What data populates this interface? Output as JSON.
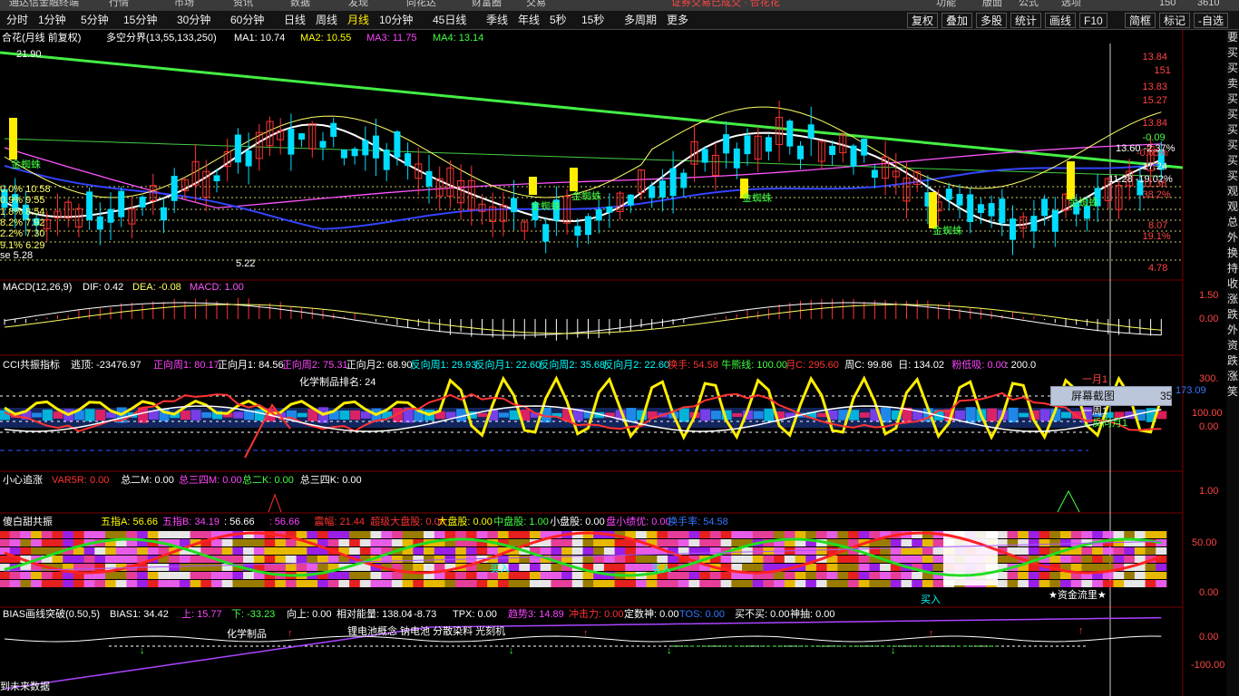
{
  "top_menu": [
    "通达信金融终端",
    "行情",
    "市场",
    "资讯",
    "数据",
    "发现",
    "同花达",
    "财富圈",
    "交易",
    "功能",
    "版面",
    "公式",
    "选项",
    "150",
    "3610"
  ],
  "top_alert": "证券交易已成交 · 合花花",
  "period_tabs": [
    "分时",
    "1分钟",
    "5分钟",
    "15分钟",
    "30分钟",
    "60分钟",
    "日线",
    "周线",
    "月线",
    "10分钟",
    "45日线",
    "季线",
    "年线",
    "5秒",
    "15秒",
    "多周期",
    "更多"
  ],
  "active_period": "月线",
  "tools": [
    "复权",
    "叠加",
    "多股",
    "统计",
    "画线",
    "F10",
    "简框",
    "标记",
    "-自选",
    "»"
  ],
  "main_panel": {
    "title": "合花(月线 前复权)",
    "indicator": "多空分界(13,55,133,250)",
    "ma": [
      {
        "label": "MA1: 10.74",
        "color": "#ffffff"
      },
      {
        "label": "MA2: 10.55",
        "color": "#ffff00"
      },
      {
        "label": "MA3: 11.75",
        "color": "#ff44ff"
      },
      {
        "label": "MA4: 13.14",
        "color": "#44ff44"
      }
    ],
    "price_labels": [
      "21.90",
      "5.22",
      "se 5.28"
    ],
    "left_fib": [
      "0.0% 10.58",
      "0.9% 9.55",
      "1.8% 8.54",
      "8.2% 7.92",
      "2.2% 7.30",
      "9.1% 6.29"
    ],
    "candle_tags": [
      "金蜘蛛",
      "金蜘蛛",
      "金蜘蛛",
      "金蜘蛛",
      "金蜘蛛",
      "金蜘蛛"
    ],
    "right_labels": [
      "13.60 -2.37%",
      "11.28 -19.02%"
    ],
    "axis": [
      "13.84",
      "151",
      "13.83",
      "15.27",
      "13.84",
      "-0.09",
      "-0.65%",
      "17.24",
      "11.36",
      "38.2%",
      "8.07",
      "19.1%",
      "4.78"
    ]
  },
  "macd": {
    "title": "MACD(12,26,9)",
    "dif": "DIF: 0.42",
    "dea": "DEA: -0.08",
    "macd": "MACD: 1.00",
    "axis": [
      "1.50",
      "0.00"
    ]
  },
  "cci": {
    "title": "CCI共振指标",
    "escape": "逃顶: -23476.97",
    "items": [
      {
        "t": "正向周1: 80.17",
        "c": "#ff44ff"
      },
      {
        "t": "正向月1: 84.56",
        "c": "#ffffff"
      },
      {
        "t": "正向周2: 75.31",
        "c": "#ff44ff"
      },
      {
        "t": "正向月2: 68.90",
        "c": "#ffffff"
      },
      {
        "t": "反向周1: 29.93",
        "c": "#00ffff"
      },
      {
        "t": "反向月1: 22.60",
        "c": "#00ffff"
      },
      {
        "t": "反向周2: 35.68",
        "c": "#00ffff"
      },
      {
        "t": "反向月2: 22.60",
        "c": "#00ffff"
      },
      {
        "t": "换手: 54.58",
        "c": "#ff3333"
      },
      {
        "t": "牛熊线: 100.00",
        "c": "#44ff44"
      },
      {
        "t": "月C: 295.60",
        "c": "#ff3333"
      },
      {
        "t": "周C: 99.86",
        "c": "#ffffff"
      },
      {
        "t": "日: 134.02",
        "c": "#ffffff"
      },
      {
        "t": "粉低吸: 0.00",
        "c": "#ff44ff"
      },
      {
        "t": ": 200.0",
        "c": "#ffffff"
      }
    ],
    "rank": "化学制品排名:  24",
    "annot": [
      "一月1",
      "一周1",
      "←反向月1"
    ],
    "axis": [
      "300.",
      "173.09",
      "100.00",
      "0.00"
    ]
  },
  "xxzz": {
    "title": "小心追涨",
    "items": [
      {
        "t": "VAR5R: 0.00",
        "c": "#ff3333"
      },
      {
        "t": "总二M: 0.00",
        "c": "#ffffff"
      },
      {
        "t": "总三四M: 0.00",
        "c": "#ff44ff"
      },
      {
        "t": "总二K: 0.00",
        "c": "#44ff44"
      },
      {
        "t": "总三四K: 0.00",
        "c": "#ffffff"
      }
    ],
    "axis": [
      "1.00"
    ]
  },
  "sbt": {
    "title": "傻白甜共振",
    "items": [
      {
        "t": "五指A: 56.66",
        "c": "#ffff00"
      },
      {
        "t": "五指B: 34.19",
        "c": "#ff44ff"
      },
      {
        "t": ": 56.66",
        "c": "#ffffff"
      },
      {
        "t": ": 56.66",
        "c": "#ff44ff"
      },
      {
        "t": "震幅: 21.44",
        "c": "#ff3333"
      },
      {
        "t": "超级大盘股: 0.00",
        "c": "#ff3333"
      },
      {
        "t": "大盘股: 0.00",
        "c": "#ffff00"
      },
      {
        "t": "中盘股: 1.00",
        "c": "#44ff44"
      },
      {
        "t": "小盘股: 0.00",
        "c": "#ffffff"
      },
      {
        "t": "盘小绩优: 0.00",
        "c": "#ff44ff"
      },
      {
        "t": "换手率: 54.58",
        "c": "#3377ff"
      }
    ],
    "buy": [
      "买入",
      "买入",
      "买入"
    ],
    "fund": "★资金流里★",
    "axis": [
      "50.00",
      "0.00"
    ]
  },
  "bias": {
    "title": "BIAS画线突破(0.50,5)",
    "items": [
      {
        "t": "BIAS1: 34.42",
        "c": "#ffffff"
      },
      {
        "t": "上: 15.77",
        "c": "#ff44ff"
      },
      {
        "t": "下: -33.23",
        "c": "#44ff44"
      },
      {
        "t": "向上: 0.00",
        "c": "#ffffff"
      },
      {
        "t": "相对能量: 138.04",
        "c": "#ffffff"
      },
      {
        "t": ": -8.73",
        "c": "#ffffff"
      },
      {
        "t": "TPX: 0.00",
        "c": "#ffffff"
      },
      {
        "t": "趋势3: 14.89",
        "c": "#ff44ff"
      },
      {
        "t": "冲击力: 0.00",
        "c": "#ff3333"
      },
      {
        "t": "定数神: 0.00",
        "c": "#ffffff"
      },
      {
        "t": "TOS: 0.00",
        "c": "#3377ff"
      },
      {
        "t": "买不买: 0.00",
        "c": "#ffffff"
      },
      {
        "t": "神抽: 0.00",
        "c": "#ffffff"
      }
    ],
    "tags": [
      "化学制品",
      "锂电池概念 钠电池 分散染料 光刻机"
    ],
    "axis": [
      "0.00",
      "-100.00"
    ],
    "footer": "到未来数据"
  },
  "popup": {
    "label": "屏幕截图",
    "count": "35"
  },
  "right_strip": [
    "要",
    "买",
    "买",
    "卖",
    "买",
    "买",
    "买",
    "买",
    "买",
    "买",
    "观",
    "观",
    "总",
    "外",
    "换",
    "持",
    "收",
    "涨",
    "跌",
    "外",
    "资",
    "跌",
    "涨",
    "笑"
  ]
}
